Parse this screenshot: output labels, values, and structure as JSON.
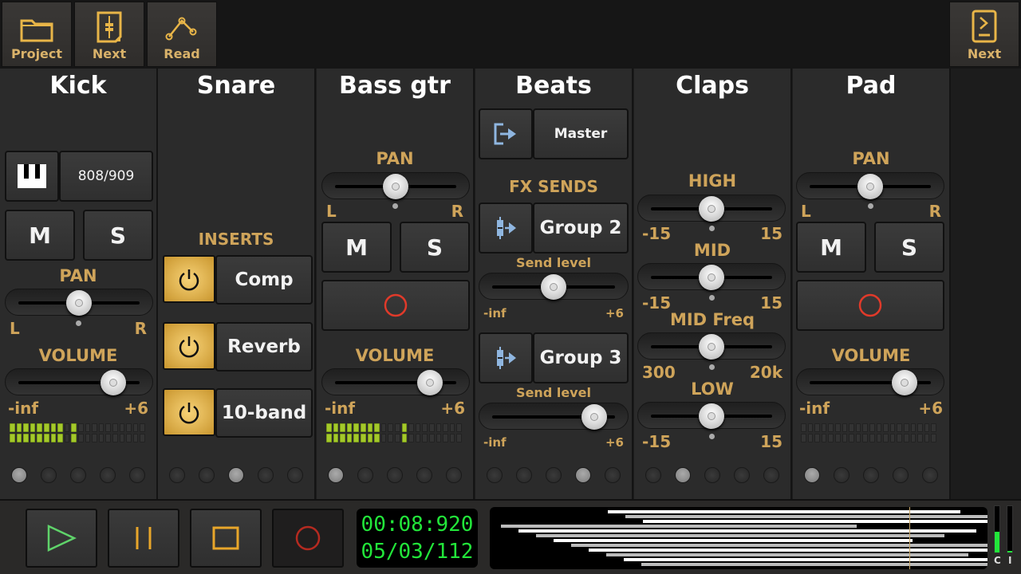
{
  "toolbar": {
    "project_label": "Project",
    "next_label": "Next",
    "read_label": "Read",
    "next_right_label": "Next",
    "icons": [
      "folder-icon",
      "mixer-page-icon",
      "automation-read-icon",
      "next-page-icon"
    ]
  },
  "colors": {
    "accent_gold": "#cfa45a",
    "meter_green": "#a4c92a",
    "clock_green": "#22e63a",
    "record_red": "#e03a2a",
    "play_green": "#5fd36a"
  },
  "channels": [
    {
      "name": "Kick",
      "instrument": "808/909",
      "mute": "M",
      "solo": "S",
      "pan_label": "PAN",
      "pan_l": "L",
      "pan_r": "R",
      "pan": 0.5,
      "volume_label": "VOLUME",
      "vol_min": "-inf",
      "vol_max": "+6",
      "volume": 0.78,
      "meter_lit": 8,
      "meter_peak": 10,
      "page": 1
    },
    {
      "name": "Snare",
      "inserts_label": "INSERTS",
      "inserts": [
        {
          "name": "Comp",
          "on": true
        },
        {
          "name": "Reverb",
          "on": true
        },
        {
          "name": "10-band",
          "on": true
        }
      ],
      "page": 3
    },
    {
      "name": "Bass gtr",
      "pan_label": "PAN",
      "pan_l": "L",
      "pan_r": "R",
      "pan": 0.5,
      "mute": "M",
      "solo": "S",
      "record": "record-arm",
      "volume_label": "VOLUME",
      "vol_min": "-inf",
      "vol_max": "+6",
      "volume": 0.78,
      "meter_lit": 8,
      "meter_peak": 12,
      "page": 1
    },
    {
      "name": "Beats",
      "output": "Master",
      "fx_label": "FX SENDS",
      "sends": [
        {
          "name": "Group 2",
          "level_label": "Send level",
          "min": "-inf",
          "max": "+6",
          "level": 0.5
        },
        {
          "name": "Group 3",
          "level_label": "Send level",
          "min": "-inf",
          "max": "+6",
          "level": 0.83
        }
      ],
      "page": 4
    },
    {
      "name": "Claps",
      "eq": [
        {
          "label": "HIGH",
          "min": "-15",
          "max": "15",
          "value": 0.5
        },
        {
          "label": "MID",
          "min": "-15",
          "max": "15",
          "value": 0.5
        },
        {
          "label": "MID Freq",
          "min": "300",
          "max": "20k",
          "value": 0.5
        },
        {
          "label": "LOW",
          "min": "-15",
          "max": "15",
          "value": 0.5
        }
      ],
      "page": 2
    },
    {
      "name": "Pad",
      "pan_label": "PAN",
      "pan_l": "L",
      "pan_r": "R",
      "pan": 0.5,
      "mute": "M",
      "solo": "S",
      "record": "record-arm",
      "volume_label": "VOLUME",
      "vol_min": "-inf",
      "vol_max": "+6",
      "volume": 0.78,
      "meter_lit": 0,
      "meter_peak": 0,
      "page": 1
    }
  ],
  "transport": {
    "time": "00:08:920",
    "position": "05/03/112",
    "clip_label_c": "C",
    "clip_label_i": "I",
    "level_c": 0.45,
    "level_i": 0.03
  }
}
